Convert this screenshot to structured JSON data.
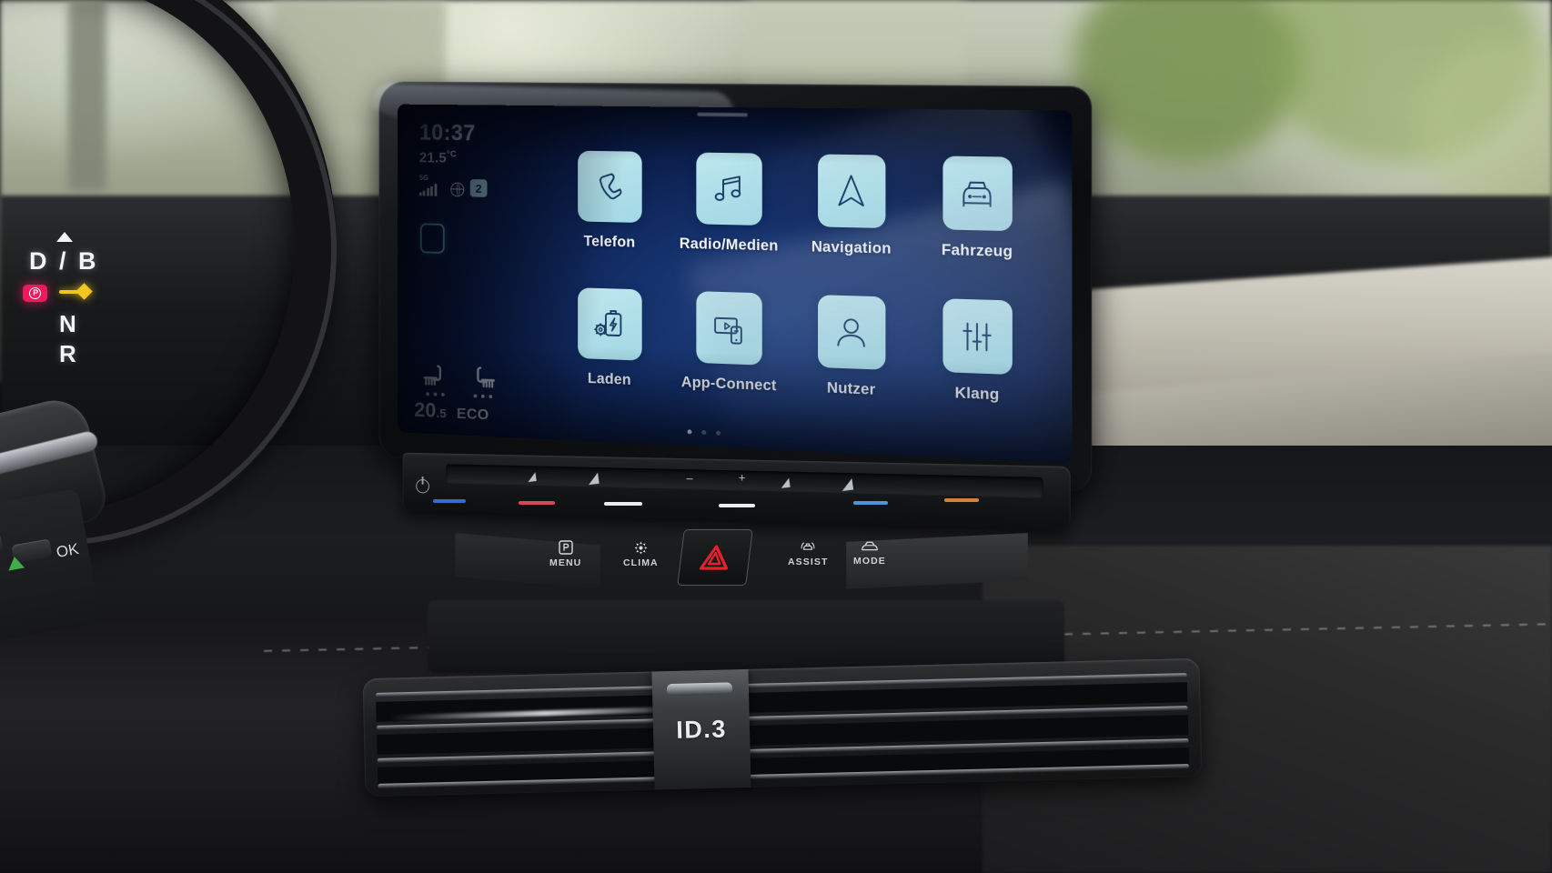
{
  "infotainment": {
    "status": {
      "time": "10:37",
      "temperature": "21.5",
      "temperature_unit": "°C",
      "network_label": "5G",
      "signal_bars": 5,
      "globe_icon": "globe-icon",
      "profile_badge": "2"
    },
    "home_button_icon": "rounded-square-icon",
    "climate": {
      "seat_left_icon": "seat-heating-icon",
      "seat_right_icon": "seat-heating-icon",
      "seat_left_level_dots": 3,
      "seat_right_level_dots": 3,
      "temperature": "20",
      "temperature_decimal": ".5",
      "mode": "ECO"
    },
    "apps": [
      {
        "label": "Telefon",
        "icon": "phone-icon"
      },
      {
        "label": "Radio/Medien",
        "icon": "music-note-icon"
      },
      {
        "label": "Navigation",
        "icon": "navigation-arrow-icon"
      },
      {
        "label": "Fahrzeug",
        "icon": "car-front-icon"
      },
      {
        "label": "Laden",
        "icon": "battery-charging-gear-icon"
      },
      {
        "label": "App-Connect",
        "icon": "screen-phone-icon"
      },
      {
        "label": "Nutzer",
        "icon": "person-icon"
      },
      {
        "label": "Klang",
        "icon": "equalizer-sliders-icon"
      }
    ],
    "pagination": {
      "total": 3,
      "active": 1
    },
    "colors": {
      "tile": "#b0e0ea",
      "icon_stroke": "#183a63",
      "screen_bg": "#10296a",
      "text": "#f2f7fd"
    }
  },
  "slider_strip": {
    "power_icon": "power-icon",
    "left_marks": [
      "fan-low-icon",
      "fan-high-icon"
    ],
    "center_marks": [
      "minus-sign",
      "plus-sign"
    ],
    "accents": [
      {
        "name": "driver-temp-cool",
        "color": "#2f6fd0"
      },
      {
        "name": "driver-temp-warm",
        "color": "#d6455c"
      },
      {
        "name": "passenger-temp-cool",
        "color": "#2f6fd0"
      },
      {
        "name": "passenger-temp-warm",
        "color": "#d6823a"
      }
    ]
  },
  "hard_buttons": [
    {
      "label": "MENU",
      "icon": "parking-p-icon"
    },
    {
      "label": "CLIMA",
      "icon": "fan-icon"
    },
    {
      "label": "ASSIST",
      "icon": "assist-car-waves-icon"
    },
    {
      "label": "MODE",
      "icon": "car-silhouette-icon"
    }
  ],
  "hazard_button": {
    "name": "hazard-warning-button",
    "icon": "warning-triangle-icon",
    "color": "#e8202c"
  },
  "cluster": {
    "up_arrow_icon": "up-triangle-icon",
    "drive_modes": "D / B",
    "park_indicator": "P",
    "park_color": "#ee1a5c",
    "selection_indicator_color": "#f3c522",
    "neutral": "N",
    "reverse": "R"
  },
  "vent": {
    "badge": "ID.3"
  }
}
